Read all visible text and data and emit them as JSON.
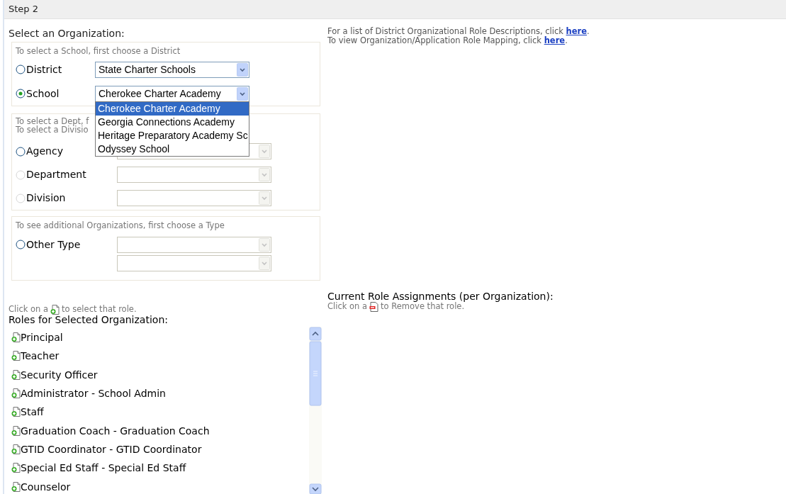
{
  "header": {
    "title": "Step 2"
  },
  "org_section": {
    "title": "Select an Organization:",
    "groups": [
      {
        "hint_lines": [
          "To select a School, first choose a District"
        ],
        "rows": [
          {
            "label": "District",
            "selected": false,
            "disabled": false,
            "selects": [
              {
                "value": "State Charter Schools",
                "disabled": false
              }
            ]
          },
          {
            "label": "School",
            "selected": true,
            "disabled": false,
            "selects": [
              {
                "value": "Cherokee Charter Academy",
                "disabled": false,
                "open": true
              }
            ]
          }
        ]
      },
      {
        "hint_lines": [
          "To select a Dept, f",
          "To select a Divisio"
        ],
        "rows": [
          {
            "label": "Agency",
            "selected": false,
            "disabled": false,
            "selects": [
              {
                "disabled": true
              }
            ]
          },
          {
            "label": "Department",
            "selected": false,
            "disabled": true,
            "selects": [
              {
                "disabled": true
              }
            ]
          },
          {
            "label": "Division",
            "selected": false,
            "disabled": true,
            "selects": [
              {
                "disabled": true
              }
            ]
          }
        ]
      },
      {
        "hint_lines": [
          "To see additional Organizations, first choose a Type"
        ],
        "rows": [
          {
            "label": "Other Type",
            "selected": false,
            "disabled": false,
            "selects": [
              {
                "disabled": true
              },
              {
                "disabled": true
              }
            ]
          }
        ]
      }
    ]
  },
  "dropdown": {
    "options": [
      {
        "label": "Cherokee Charter Academy",
        "selected": true
      },
      {
        "label": "Georgia Connections Academy",
        "selected": false
      },
      {
        "label": "Heritage Preparatory Academy Sc",
        "selected": false
      },
      {
        "label": "Odyssey School",
        "selected": false
      }
    ]
  },
  "info_links": [
    {
      "text": "For a list of District Organizational Role Descriptions, click",
      "link": "here",
      "after": "."
    },
    {
      "text": "To view Organization/Application Role Mapping, click",
      "link": "here",
      "after": "."
    }
  ],
  "roles": {
    "hint_before": "Click on a",
    "hint_after": "to select that role.",
    "title": "Roles for Selected Organization:",
    "items": [
      "Principal",
      "Teacher",
      "Security Officer",
      "Administrator - School Admin",
      "Staff",
      "Graduation Coach - Graduation Coach",
      "GTID Coordinator - GTID Coordinator",
      "Special Ed Staff - Special Ed Staff",
      "Counselor"
    ]
  },
  "assignments": {
    "title": "Current Role Assignments (per Organization):",
    "hint_before": "Click on a",
    "hint_after": "to Remove that role."
  }
}
